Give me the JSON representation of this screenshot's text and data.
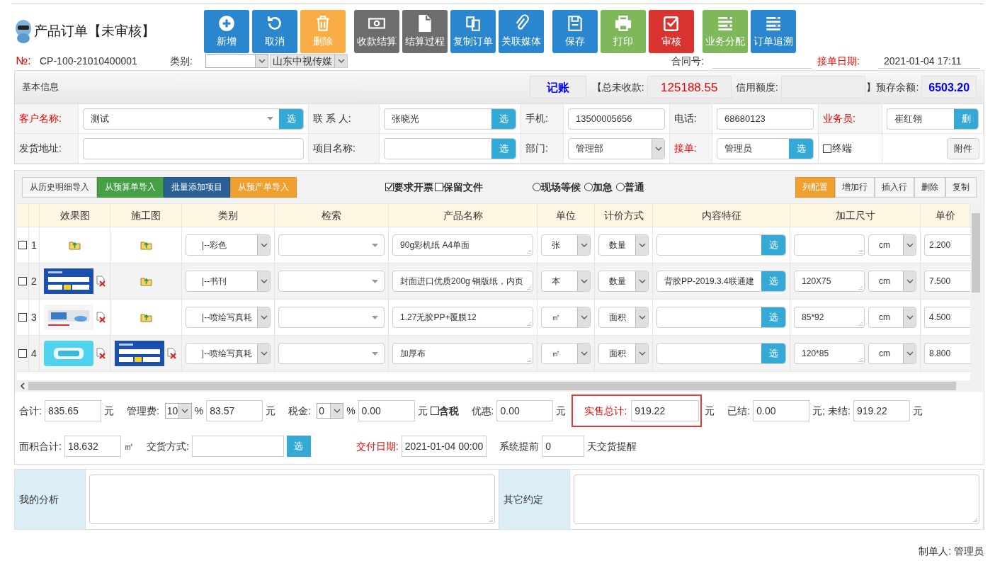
{
  "title": "产品订单【未审核】",
  "toolbar": [
    [
      {
        "label": "新增",
        "kind": "blue"
      },
      {
        "label": "取消",
        "kind": "blue"
      },
      {
        "label": "删除",
        "kind": "orange"
      }
    ],
    [
      {
        "label": "收款结算",
        "kind": "gray"
      },
      {
        "label": "结算过程",
        "kind": "gray"
      },
      {
        "label": "复制订单",
        "kind": "blue"
      },
      {
        "label": "关联媒体",
        "kind": "blue"
      }
    ],
    [
      {
        "label": "保存",
        "kind": "blue"
      },
      {
        "label": "打印",
        "kind": "green"
      },
      {
        "label": "审核",
        "kind": "red"
      }
    ],
    [
      {
        "label": "业务分配",
        "kind": "green"
      },
      {
        "label": "订单追溯",
        "kind": "blue"
      }
    ]
  ],
  "header": {
    "no_label": "№:",
    "no_value": "CP-100-21010400001",
    "category_label": "类别:",
    "company": "山东中视传媒",
    "contract_label": "合同号:",
    "date_label": "接单日期:",
    "date_value": "2021-01-04 17:11"
  },
  "summary": {
    "title": "基本信息",
    "mode": "记账",
    "unpaid_label": "【总未收款:",
    "unpaid": "125188.55",
    "credit_label": "信用额度:",
    "deposit_label": "】预存余额:",
    "deposit": "6503.20"
  },
  "form_rows": [
    [
      {
        "kind": "combo",
        "label": "客户名称:",
        "required": true,
        "value": "测试",
        "button": "选"
      },
      {
        "kind": "input",
        "label": "联 系 人:",
        "required": false,
        "value": "张晓光",
        "button": "选"
      },
      {
        "kind": "input",
        "label": "手机:",
        "required": false,
        "value": "13500005656"
      },
      {
        "kind": "input",
        "label": "电话:",
        "required": false,
        "value": "68680123"
      },
      {
        "kind": "input",
        "label": "业务员:",
        "required": true,
        "value": "崔红翎",
        "button": "删"
      }
    ],
    [
      {
        "kind": "input",
        "label": "发货地址:",
        "required": false
      },
      {
        "kind": "input",
        "label": "项目名称:",
        "required": false,
        "button": "选"
      },
      {
        "kind": "select",
        "label": "部门:",
        "required": false,
        "value": "管理部"
      },
      {
        "kind": "input",
        "label": "接单:",
        "required": true,
        "value": "管理员",
        "button": "选"
      },
      {
        "kind": "check",
        "label": "终端",
        "checked": false,
        "button": "附件"
      }
    ]
  ],
  "import_buttons": [
    {
      "label": "从历史明细导入",
      "kind": "white"
    },
    {
      "label": "从预算单导入",
      "kind": "green"
    },
    {
      "label": "批量添加项目",
      "kind": "navy"
    },
    {
      "label": "从预产单导入",
      "kind": "orange"
    }
  ],
  "options": [
    {
      "label": "要求开票",
      "checked": true
    },
    {
      "label": "保留文件",
      "checked": false
    }
  ],
  "urgency": [
    {
      "label": "现场等候",
      "selected": false
    },
    {
      "label": "加急",
      "selected": false
    },
    {
      "label": "普通",
      "selected": false
    }
  ],
  "row_buttons": [
    {
      "label": "列配置",
      "kind": "orange"
    },
    {
      "label": "增加行",
      "kind": "white"
    },
    {
      "label": "插入行",
      "kind": "white"
    },
    {
      "label": "删除",
      "kind": "white"
    },
    {
      "label": "复制",
      "kind": "white"
    }
  ],
  "table": {
    "columns": [
      "效果图",
      "施工图",
      "类别",
      "检索",
      "产品名称",
      "单位",
      "计价方式",
      "内容特征",
      "加工尺寸",
      "单价"
    ],
    "rows": [
      {
        "checked": false,
        "num": "1",
        "effect": {
          "kind": "upload"
        },
        "construction": {
          "kind": "upload"
        },
        "category": "|--彩色",
        "pick_button": "选",
        "product": "90g彩机纸 A4单面",
        "unit": "张",
        "pricing": "数量",
        "size_unit": "cm",
        "price": "2.200"
      },
      {
        "checked": false,
        "num": "2",
        "construction": {
          "kind": "upload"
        },
        "category": "|--书刊",
        "pick_button": "选",
        "product": "封面进口优质200g 铜版纸，内页",
        "unit": "本",
        "pricing": "数量",
        "feature": "背胶PP-2019.3.4联通建",
        "size": "120X75",
        "size_unit": "cm",
        "price": "7.500"
      },
      {
        "checked": false,
        "num": "3",
        "construction": {
          "kind": "upload"
        },
        "category": "|--喷绘写真耗",
        "pick_button": "选",
        "product": "1.27无胶PP+覆膜12",
        "unit": "㎡",
        "pricing": "面积",
        "size": "85*92",
        "size_unit": "cm",
        "price": "4.500"
      },
      {
        "checked": false,
        "num": "4",
        "category": "|--喷绘写真耗",
        "pick_button": "选",
        "product": "加厚布",
        "unit": "㎡",
        "pricing": "面积",
        "size": "120*85",
        "size_unit": "cm",
        "price": "8.800"
      }
    ]
  },
  "totals": [
    [
      {
        "kind": "label",
        "text": "合计:"
      },
      {
        "kind": "input",
        "text": "835.65"
      },
      {
        "kind": "unit",
        "text": "元"
      },
      {
        "kind": "label",
        "text": "管理费:"
      },
      {
        "kind": "select",
        "text": "10"
      },
      {
        "kind": "unit",
        "text": "%"
      },
      {
        "kind": "input",
        "text": "83.57"
      },
      {
        "kind": "unit",
        "text": "元"
      },
      {
        "kind": "label",
        "text": "税金:"
      },
      {
        "kind": "select",
        "text": "0"
      },
      {
        "kind": "unit",
        "text": "%"
      },
      {
        "kind": "input",
        "text": "0.00"
      },
      {
        "kind": "unit",
        "text": "元"
      },
      {
        "kind": "check",
        "text": "含税",
        "checked": false
      },
      {
        "kind": "label",
        "text": "优惠:"
      },
      {
        "kind": "input",
        "text": "0.00"
      },
      {
        "kind": "unit",
        "text": "元"
      },
      {
        "kind": "highlight",
        "text": "实售总计:",
        "value": "919.22"
      },
      {
        "kind": "unit",
        "text": "元"
      },
      {
        "kind": "label",
        "text": "已结:"
      },
      {
        "kind": "input",
        "text": "0.00"
      },
      {
        "kind": "unit",
        "text": "元; 未结:"
      },
      {
        "kind": "input",
        "text": "919.22"
      },
      {
        "kind": "unit",
        "text": "元"
      }
    ],
    [
      {
        "kind": "label",
        "text": "面积合计:"
      },
      {
        "kind": "input",
        "text": "18.632"
      },
      {
        "kind": "unit",
        "text": "㎡"
      },
      {
        "kind": "label",
        "text": "交货方式:"
      },
      {
        "kind": "pick",
        "button": "选"
      },
      {
        "kind": "redlabel",
        "text": "交付日期:"
      },
      {
        "kind": "input",
        "text": "2021-01-04 00:00"
      },
      {
        "kind": "label",
        "text": "系统提前"
      },
      {
        "kind": "small",
        "text": "0"
      },
      {
        "kind": "unit",
        "text": "天交货提醒"
      }
    ]
  ],
  "notes": [
    {
      "label": "我的分析"
    },
    {
      "label": "其它约定"
    }
  ],
  "creator": "制单人: 管理员"
}
